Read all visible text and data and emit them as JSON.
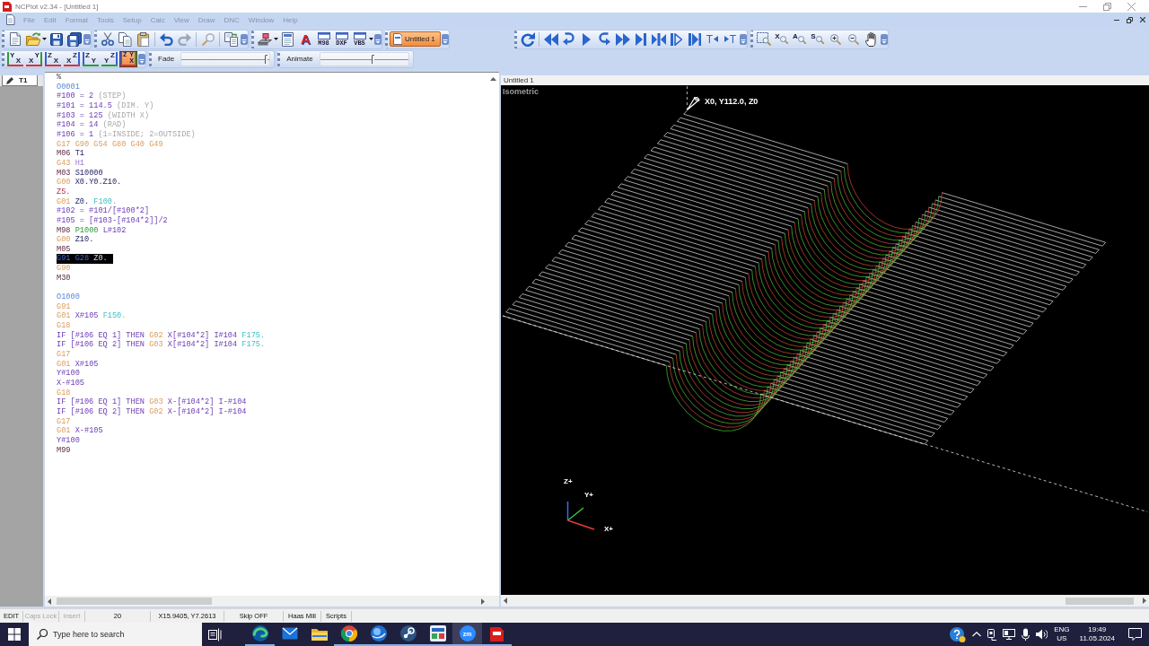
{
  "window": {
    "title": "NCPlot v2.34 - [Untitled 1]"
  },
  "menu": [
    "File",
    "Edit",
    "Format",
    "Tools",
    "Setup",
    "Calc",
    "View",
    "Draw",
    "DNC",
    "Window",
    "Help"
  ],
  "toolbar": {
    "text_buttons": [
      {
        "label": "A",
        "kind": "letter"
      },
      {
        "label": "M98",
        "kind": "labeled"
      },
      {
        "label": "DXF",
        "kind": "labeled"
      },
      {
        "label": "VBS",
        "kind": "labeled"
      }
    ],
    "document_tab": {
      "label": "Untitled 1",
      "selected": true
    }
  },
  "view_buttons": [
    {
      "kind": "left",
      "selected": false,
      "letters": [
        {
          "text": "Y",
          "color": "#2f9b3a"
        },
        {
          "text": "X",
          "color": "#d8323a"
        }
      ]
    },
    {
      "kind": "right",
      "selected": false,
      "letters": [
        {
          "text": "X",
          "color": "#d8323a"
        },
        {
          "text": "Y",
          "color": "#2f9b3a"
        }
      ]
    },
    {
      "kind": "left",
      "selected": false,
      "letters": [
        {
          "text": "Z",
          "color": "#3a5fd0"
        },
        {
          "text": "X",
          "color": "#d8323a"
        }
      ]
    },
    {
      "kind": "right",
      "selected": false,
      "letters": [
        {
          "text": "X",
          "color": "#d8323a"
        },
        {
          "text": "Z",
          "color": "#3a5fd0"
        }
      ]
    },
    {
      "kind": "left",
      "selected": false,
      "letters": [
        {
          "text": "Z",
          "color": "#3a5fd0"
        },
        {
          "text": "Y",
          "color": "#2f9b3a"
        }
      ]
    },
    {
      "kind": "right",
      "selected": false,
      "letters": [
        {
          "text": "Y",
          "color": "#2f9b3a"
        },
        {
          "text": "Z",
          "color": "#3a5fd0"
        }
      ]
    },
    {
      "kind": "iso",
      "selected": true,
      "letters": [
        {
          "text": "Z",
          "color": "#3a5fd0"
        },
        {
          "text": "Y",
          "color": "#2f9b3a"
        },
        {
          "text": "X",
          "color": "#d8323a"
        }
      ]
    }
  ],
  "fade": {
    "label": "Fade",
    "level": 0.97
  },
  "animate": {
    "label": "Animate",
    "level": 0.61
  },
  "playback_toolbar": {
    "text_buttons": [
      {
        "label": "T",
        "kind": "left"
      },
      {
        "label": "T",
        "kind": "right"
      }
    ]
  },
  "zoom_toolbar": {
    "letter_buttons": [
      {
        "label": "X"
      },
      {
        "label": "A"
      },
      {
        "label": "S"
      }
    ]
  },
  "tool_list": {
    "tabs": [
      {
        "label": "T1"
      }
    ]
  },
  "editor": {
    "lines": [
      {
        "selected": false,
        "tokens": [
          {
            "text": "%",
            "kind": "plain"
          }
        ]
      },
      {
        "selected": false,
        "tokens": [
          {
            "text": "O0001",
            "kind": "program"
          }
        ]
      },
      {
        "selected": false,
        "tokens": [
          {
            "text": "#100 = 2",
            "kind": "macro"
          },
          {
            "text": "(STEP)",
            "kind": "comment"
          }
        ]
      },
      {
        "selected": false,
        "tokens": [
          {
            "text": "#101 = 114.5",
            "kind": "macro"
          },
          {
            "text": "(DIM. Y)",
            "kind": "comment"
          }
        ]
      },
      {
        "selected": false,
        "tokens": [
          {
            "text": "#103 = 125",
            "kind": "macro"
          },
          {
            "text": "(WIDTH X)",
            "kind": "comment"
          }
        ]
      },
      {
        "selected": false,
        "tokens": [
          {
            "text": "#104 = 14",
            "kind": "macro"
          },
          {
            "text": "(RAD)",
            "kind": "comment"
          }
        ]
      },
      {
        "selected": false,
        "tokens": [
          {
            "text": "#106 = 1",
            "kind": "macro"
          },
          {
            "text": "(1=INSIDE; 2=OUTSIDE)",
            "kind": "comment"
          }
        ]
      },
      {
        "selected": false,
        "tokens": [
          {
            "text": "G17 G90 G54 G80 G40 G49",
            "kind": "gcode"
          }
        ]
      },
      {
        "selected": false,
        "tokens": [
          {
            "text": "M06",
            "kind": "mcode"
          },
          {
            "text": "T1",
            "kind": "coord"
          }
        ]
      },
      {
        "selected": false,
        "tokens": [
          {
            "text": "G43",
            "kind": "gcode"
          },
          {
            "text": "H1",
            "kind": "offset"
          }
        ]
      },
      {
        "selected": false,
        "tokens": [
          {
            "text": "M03",
            "kind": "mcode"
          },
          {
            "text": "S10000",
            "kind": "coord"
          }
        ]
      },
      {
        "selected": false,
        "tokens": [
          {
            "text": "G00",
            "kind": "gcode"
          },
          {
            "text": "X0.Y0.Z10.",
            "kind": "coord"
          }
        ]
      },
      {
        "selected": false,
        "tokens": [
          {
            "text": "Z5.",
            "kind": "depth"
          }
        ]
      },
      {
        "selected": false,
        "tokens": [
          {
            "text": "G01",
            "kind": "gcode"
          },
          {
            "text": "Z0.",
            "kind": "coord"
          },
          {
            "text": "F100.",
            "kind": "feed"
          }
        ]
      },
      {
        "selected": false,
        "tokens": [
          {
            "text": "#102 = #101/[#100*2]",
            "kind": "macro"
          }
        ]
      },
      {
        "selected": false,
        "tokens": [
          {
            "text": "#105 = [#103-[#104*2]]/2",
            "kind": "macro"
          }
        ]
      },
      {
        "selected": false,
        "tokens": [
          {
            "text": "M98",
            "kind": "mcode"
          },
          {
            "text": "P1000",
            "kind": "param"
          },
          {
            "text": "L#102",
            "kind": "macro"
          }
        ]
      },
      {
        "selected": false,
        "tokens": [
          {
            "text": "G00",
            "kind": "gcode"
          },
          {
            "text": "Z10.",
            "kind": "coord"
          }
        ]
      },
      {
        "selected": false,
        "tokens": [
          {
            "text": "M05",
            "kind": "mcode"
          }
        ]
      },
      {
        "selected": true,
        "tokens": [
          {
            "text": "G91 G28",
            "kind": "gcode"
          },
          {
            "text": "Z0.",
            "kind": "coord"
          }
        ]
      },
      {
        "selected": false,
        "tokens": [
          {
            "text": "G90",
            "kind": "gcode"
          }
        ]
      },
      {
        "selected": false,
        "tokens": [
          {
            "text": "M30",
            "kind": "mcode"
          }
        ]
      },
      {
        "selected": false
      },
      {
        "selected": false,
        "tokens": [
          {
            "text": "O1000",
            "kind": "program"
          }
        ]
      },
      {
        "selected": false,
        "tokens": [
          {
            "text": "G91",
            "kind": "gcode"
          }
        ]
      },
      {
        "selected": false,
        "tokens": [
          {
            "text": "G01",
            "kind": "gcode"
          },
          {
            "text": "X#105",
            "kind": "macro"
          },
          {
            "text": "F150.",
            "kind": "feed"
          }
        ]
      },
      {
        "selected": false,
        "tokens": [
          {
            "text": "G18",
            "kind": "gcode"
          }
        ]
      },
      {
        "selected": false,
        "tokens": [
          {
            "text": "IF [#106 EQ 1] THEN",
            "kind": "macro"
          },
          {
            "text": "G02",
            "kind": "gcode"
          },
          {
            "text": "X[#104*2] I#104",
            "kind": "macro"
          },
          {
            "text": "F175.",
            "kind": "feed"
          }
        ]
      },
      {
        "selected": false,
        "tokens": [
          {
            "text": "IF [#106 EQ 2] THEN",
            "kind": "macro"
          },
          {
            "text": "G03",
            "kind": "gcode"
          },
          {
            "text": "X[#104*2] I#104",
            "kind": "macro"
          },
          {
            "text": "F175.",
            "kind": "feed"
          }
        ]
      },
      {
        "selected": false,
        "tokens": [
          {
            "text": "G17",
            "kind": "gcode"
          }
        ]
      },
      {
        "selected": false,
        "tokens": [
          {
            "text": "G01",
            "kind": "gcode"
          },
          {
            "text": "X#105",
            "kind": "macro"
          }
        ]
      },
      {
        "selected": false,
        "tokens": [
          {
            "text": "Y#100",
            "kind": "macro"
          }
        ]
      },
      {
        "selected": false,
        "tokens": [
          {
            "text": "X-#105",
            "kind": "macro"
          }
        ]
      },
      {
        "selected": false,
        "tokens": [
          {
            "text": "G18",
            "kind": "gcode"
          }
        ]
      },
      {
        "selected": false,
        "tokens": [
          {
            "text": "IF [#106 EQ 1] THEN",
            "kind": "macro"
          },
          {
            "text": "G03",
            "kind": "gcode"
          },
          {
            "text": "X-[#104*2] I-#104",
            "kind": "macro"
          }
        ]
      },
      {
        "selected": false,
        "tokens": [
          {
            "text": "IF [#106 EQ 2] THEN",
            "kind": "macro"
          },
          {
            "text": "G02",
            "kind": "gcode"
          },
          {
            "text": "X-[#104*2] I-#104",
            "kind": "macro"
          }
        ]
      },
      {
        "selected": false,
        "tokens": [
          {
            "text": "G17",
            "kind": "gcode"
          }
        ]
      },
      {
        "selected": false,
        "tokens": [
          {
            "text": "G01",
            "kind": "gcode"
          },
          {
            "text": "X-#105",
            "kind": "macro"
          }
        ]
      },
      {
        "selected": false,
        "tokens": [
          {
            "text": "Y#100",
            "kind": "macro"
          }
        ]
      },
      {
        "selected": false,
        "tokens": [
          {
            "text": "M99",
            "kind": "mcode"
          }
        ]
      }
    ]
  },
  "viewport": {
    "title": "Untitled 1",
    "view_name": "Isometric",
    "position": "X0, Y112.0, Z0",
    "axes": [
      "Z+",
      "Y+",
      "X+"
    ]
  },
  "status_bar": [
    {
      "text": "EDIT",
      "disabled": false
    },
    {
      "text": "Caps Lock",
      "disabled": true
    },
    {
      "text": "Insert",
      "disabled": true
    },
    {
      "text": "20",
      "disabled": false
    },
    {
      "text": "X15.9405, Y7.2613",
      "disabled": false
    },
    {
      "text": "Skip OFF",
      "disabled": false
    },
    {
      "text": "Haas Mill",
      "disabled": false
    },
    {
      "text": "Scripts",
      "disabled": false
    }
  ],
  "taskbar": {
    "search": {
      "placeholder": "Type here to search"
    },
    "apps": [
      {
        "running": true,
        "selected": false
      },
      {
        "running": false,
        "selected": false
      },
      {
        "running": false,
        "selected": false
      },
      {
        "running": true,
        "selected": false
      },
      {
        "running": true,
        "selected": false
      },
      {
        "running": true,
        "selected": false
      },
      {
        "running": true,
        "selected": false
      },
      {
        "label": "zm",
        "running": true,
        "selected": true
      },
      {
        "running": true,
        "selected": false
      }
    ],
    "language": {
      "top": "ENG",
      "bottom": "US"
    },
    "clock": {
      "time": "19:49",
      "date": "11.05.2024"
    }
  }
}
